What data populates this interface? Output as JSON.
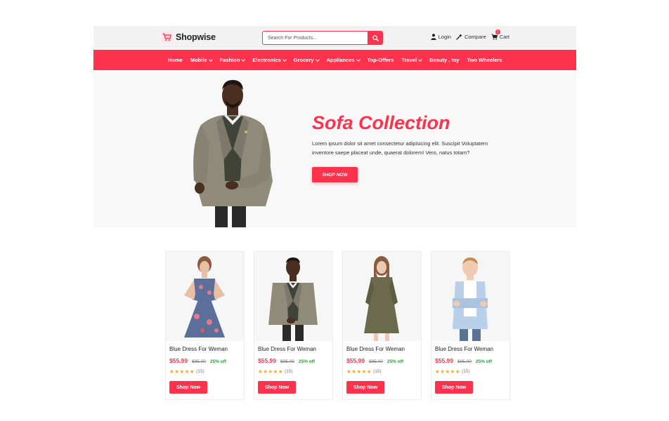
{
  "header": {
    "brand": "Shopwise",
    "search_placeholder": "Search For Products...",
    "login": "Login",
    "compare": "Compare",
    "cart": "Cart",
    "cart_count": "0"
  },
  "nav": [
    {
      "label": "Home",
      "dropdown": false
    },
    {
      "label": "Mobile",
      "dropdown": true
    },
    {
      "label": "Fashion",
      "dropdown": true
    },
    {
      "label": "Electronics",
      "dropdown": true
    },
    {
      "label": "Grocery",
      "dropdown": true
    },
    {
      "label": "Appliances",
      "dropdown": true
    },
    {
      "label": "Top-Offers",
      "dropdown": false
    },
    {
      "label": "Travel",
      "dropdown": true
    },
    {
      "label": "Beauty , toy",
      "dropdown": false
    },
    {
      "label": "Two Wheelers",
      "dropdown": false
    }
  ],
  "hero": {
    "title": "Sofa Collection",
    "description": "Lorem ipsum dolor sit amet consectetur adipisicing elit. Suscipit Voluptatem inventore saepe placeat unde, quaerat dolorem! Vero, natus totam?",
    "button": "SHOP NOW"
  },
  "products": [
    {
      "name": "Blue Dress For Weman",
      "price": "$55.99",
      "old_price": "$95.00",
      "discount": "25% off",
      "stars": "★★★★★",
      "reviews": "(15)",
      "button": "Shop Now"
    },
    {
      "name": "Blue Dress For Weman",
      "price": "$55.99",
      "old_price": "$95.00",
      "discount": "25% off",
      "stars": "★★★★★",
      "reviews": "(15)",
      "button": "Shop Now"
    },
    {
      "name": "Blue Dress For Weman",
      "price": "$55.99",
      "old_price": "$95.00",
      "discount": "25% off",
      "stars": "★★★★★",
      "reviews": "(15)",
      "button": "Shop Now"
    },
    {
      "name": "Blue Dress For Weman",
      "price": "$55.99",
      "old_price": "$95.00",
      "discount": "25% off",
      "stars": "★★★★★",
      "reviews": "(15)",
      "button": "Shop Now"
    }
  ],
  "colors": {
    "accent": "#ff324d",
    "discount": "#2a9d3a",
    "star": "#f5a623"
  }
}
